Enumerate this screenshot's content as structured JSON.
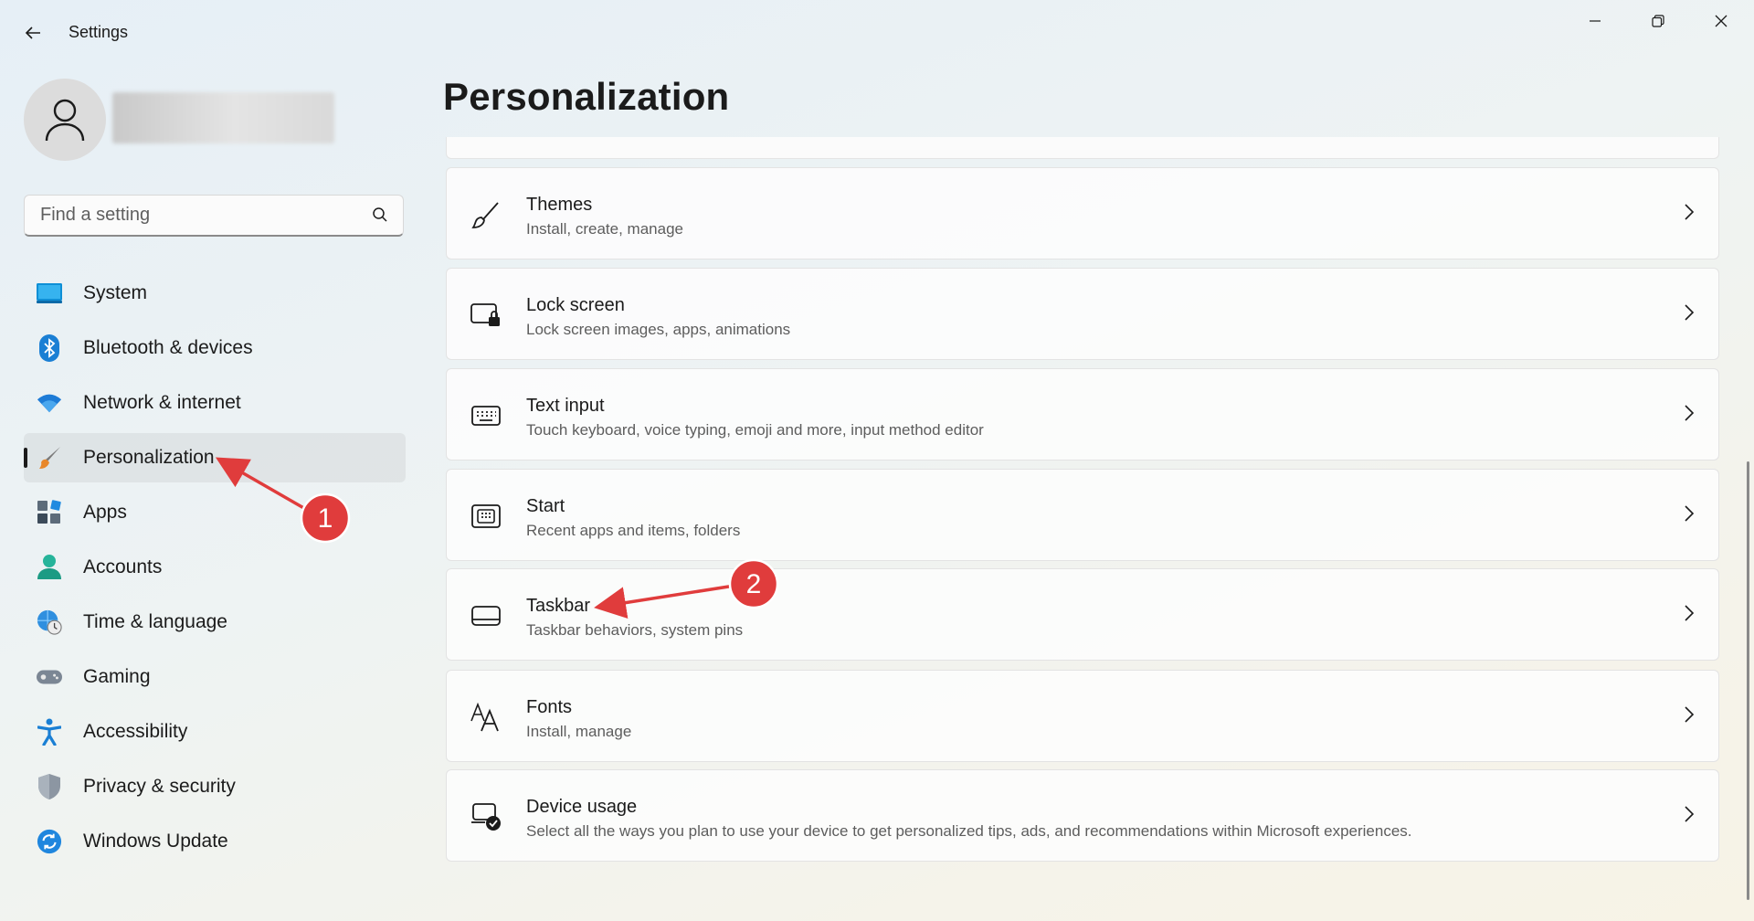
{
  "window": {
    "title": "Settings",
    "controls": [
      "minimize",
      "restore",
      "close"
    ]
  },
  "search": {
    "placeholder": "Find a setting",
    "value": ""
  },
  "sidebar": {
    "items": [
      {
        "label": "System",
        "icon": "system-monitor-icon",
        "active": false
      },
      {
        "label": "Bluetooth & devices",
        "icon": "bluetooth-icon",
        "active": false
      },
      {
        "label": "Network & internet",
        "icon": "wifi-icon",
        "active": false
      },
      {
        "label": "Personalization",
        "icon": "paintbrush-icon",
        "active": true
      },
      {
        "label": "Apps",
        "icon": "apps-icon",
        "active": false
      },
      {
        "label": "Accounts",
        "icon": "person-icon",
        "active": false
      },
      {
        "label": "Time & language",
        "icon": "globe-clock-icon",
        "active": false
      },
      {
        "label": "Gaming",
        "icon": "gamepad-icon",
        "active": false
      },
      {
        "label": "Accessibility",
        "icon": "accessibility-icon",
        "active": false
      },
      {
        "label": "Privacy & security",
        "icon": "shield-icon",
        "active": false
      },
      {
        "label": "Windows Update",
        "icon": "update-icon",
        "active": false
      }
    ]
  },
  "main": {
    "title": "Personalization",
    "cards": [
      {
        "title": "Themes",
        "subtitle": "Install, create, manage",
        "icon": "brush-icon"
      },
      {
        "title": "Lock screen",
        "subtitle": "Lock screen images, apps, animations",
        "icon": "lock-screen-icon"
      },
      {
        "title": "Text input",
        "subtitle": "Touch keyboard, voice typing, emoji and more, input method editor",
        "icon": "keyboard-icon"
      },
      {
        "title": "Start",
        "subtitle": "Recent apps and items, folders",
        "icon": "start-icon"
      },
      {
        "title": "Taskbar",
        "subtitle": "Taskbar behaviors, system pins",
        "icon": "taskbar-icon"
      },
      {
        "title": "Fonts",
        "subtitle": "Install, manage",
        "icon": "fonts-icon"
      },
      {
        "title": "Device usage",
        "subtitle": "Select all the ways you plan to use your device to get personalized tips, ads, and recommendations within Microsoft experiences.",
        "icon": "device-usage-icon"
      }
    ]
  },
  "annotations": {
    "step1": "1",
    "step2": "2",
    "color": "#e03c3c"
  }
}
